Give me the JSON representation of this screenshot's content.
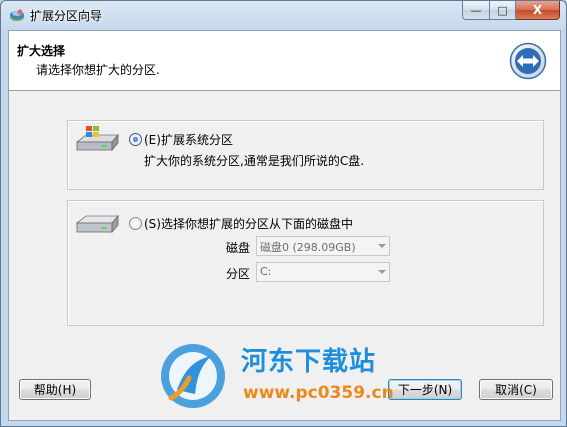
{
  "window": {
    "title": "扩展分区向导",
    "buttons": {
      "minimize": "—",
      "maximize": "□",
      "close": "X"
    }
  },
  "header": {
    "title": "扩大选择",
    "subtitle": "请选择你想扩大的分区."
  },
  "option_system": {
    "label": "(E)扩展系统分区",
    "description": "扩大你的系统分区,通常是我们所说的C盘.",
    "selected": true
  },
  "option_other": {
    "label": "(S)选择你想扩展的分区从下面的磁盘中",
    "selected": false,
    "disk_label": "磁盘",
    "disk_value": "磁盘0 (298.09GB)",
    "partition_label": "分区",
    "partition_value": "C:"
  },
  "footer": {
    "help": "帮助(H)",
    "next": "下一步(N)",
    "cancel": "取消(C)"
  },
  "watermark": {
    "name": "河东下载站",
    "url": "www.pc0359.cn"
  }
}
